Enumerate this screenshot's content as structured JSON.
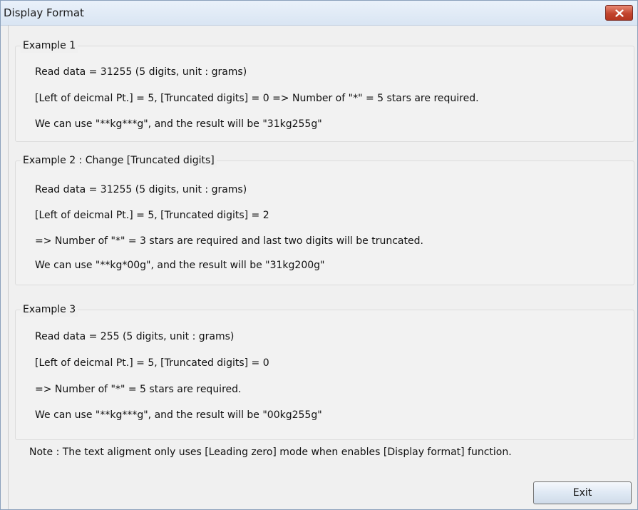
{
  "window": {
    "title": "Display Format",
    "close_icon": "close-icon"
  },
  "groups": [
    {
      "title": "Example 1",
      "lines": [
        "Read data = 31255 (5 digits, unit : grams)",
        "[Left of deicmal Pt.] = 5, [Truncated digits] = 0 => Number of \"*\" = 5 stars are required.",
        "We can use \"**kg***g\", and the result will be \"31kg255g\""
      ]
    },
    {
      "title": "Example 2 : Change [Truncated digits]",
      "lines": [
        "Read data = 31255 (5 digits, unit : grams)",
        "[Left of deicmal Pt.] = 5, [Truncated digits] = 2",
        "=> Number of \"*\" = 3 stars are required and last two digits will be truncated.",
        "We can use \"**kg*00g\", and the result will be \"31kg200g\""
      ]
    },
    {
      "title": "Example 3",
      "lines": [
        "Read data = 255 (5 digits, unit : grams)",
        "[Left of deicmal Pt.] = 5, [Truncated digits] = 0",
        "=> Number of \"*\" = 5 stars are required.",
        "We can use \"**kg***g\", and the result will be \"00kg255g\""
      ]
    }
  ],
  "note": "Note : The text aligment only uses [Leading zero] mode when enables [Display format] function.",
  "buttons": {
    "exit_label": "Exit"
  },
  "colors": {
    "close_button": "#c2452e",
    "titlebar": "#dfe8f4"
  }
}
